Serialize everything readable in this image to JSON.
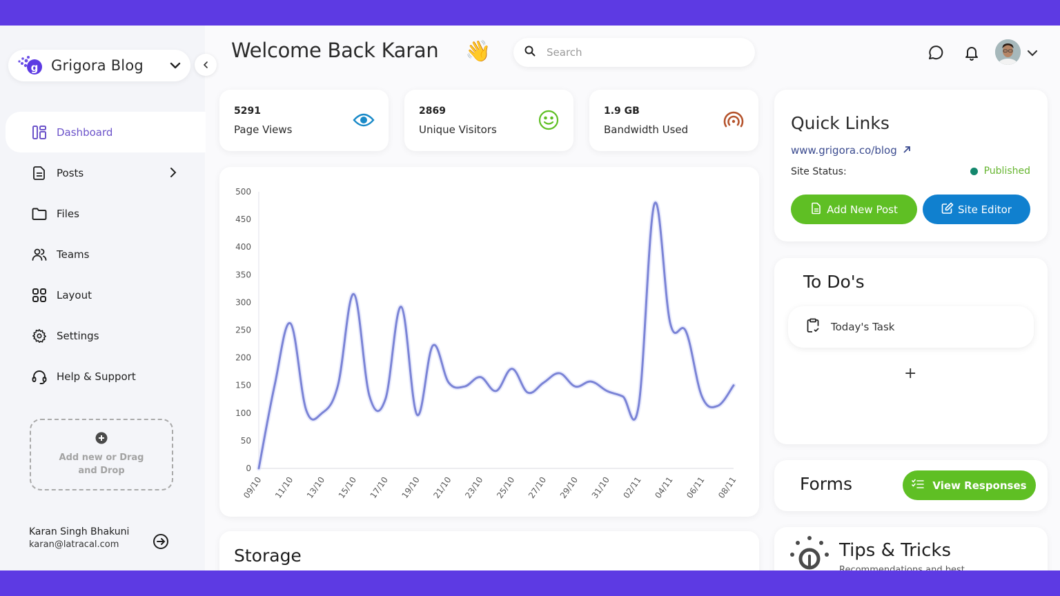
{
  "brand": {
    "name": "Grigora Blog"
  },
  "sidebar": {
    "items": [
      {
        "label": "Dashboard",
        "icon": "dashboard-icon",
        "active": true
      },
      {
        "label": "Posts",
        "icon": "document-icon",
        "has_submenu": true
      },
      {
        "label": "Files",
        "icon": "folder-icon"
      },
      {
        "label": "Teams",
        "icon": "users-icon"
      },
      {
        "label": "Layout",
        "icon": "grid-icon"
      },
      {
        "label": "Settings",
        "icon": "gear-icon"
      },
      {
        "label": "Help & Support",
        "icon": "headset-icon"
      }
    ],
    "dropzone_label": "Add new or Drag and Drop",
    "user": {
      "name": "Karan Singh Bhakuni",
      "email": "karan@latracal.com"
    }
  },
  "header": {
    "welcome": "Welcome Back Karan",
    "wave_emoji": "👋",
    "search_placeholder": "Search"
  },
  "stats": [
    {
      "value": "5291",
      "label": "Page Views",
      "icon": "eye-icon",
      "color": "#1a8ac8"
    },
    {
      "value": "2869",
      "label": "Unique Visitors",
      "icon": "smiley-icon",
      "color": "#5fbf24"
    },
    {
      "value": "1.9 GB",
      "label": "Bandwidth Used",
      "icon": "broadcast-icon",
      "color": "#b5532c"
    }
  ],
  "chart_data": {
    "type": "line",
    "title": "",
    "xlabel": "",
    "ylabel": "",
    "ylim": [
      0,
      500
    ],
    "yticks": [
      0,
      50,
      100,
      150,
      200,
      250,
      300,
      350,
      400,
      450,
      500
    ],
    "x_tick_labels": [
      "09/10",
      "11/10",
      "13/10",
      "15/10",
      "17/10",
      "19/10",
      "21/10",
      "23/10",
      "25/10",
      "27/10",
      "29/10",
      "31/10",
      "02/11",
      "04/11",
      "06/11",
      "08/11"
    ],
    "series": [
      {
        "name": "Page Views",
        "color": "#7b84d6",
        "x": [
          "09/10",
          "10/10",
          "11/10",
          "12/10",
          "13/10",
          "14/10",
          "15/10",
          "16/10",
          "17/10",
          "18/10",
          "19/10",
          "20/10",
          "21/10",
          "22/10",
          "23/10",
          "24/10",
          "25/10",
          "26/10",
          "27/10",
          "28/10",
          "29/10",
          "30/10",
          "31/10",
          "01/11",
          "02/11",
          "03/11",
          "04/11",
          "05/11",
          "06/11",
          "07/11",
          "08/11"
        ],
        "values": [
          0,
          150,
          262,
          105,
          100,
          150,
          315,
          130,
          125,
          292,
          97,
          222,
          155,
          148,
          165,
          140,
          180,
          137,
          155,
          172,
          148,
          157,
          140,
          130,
          113,
          478,
          262,
          247,
          130,
          113,
          150
        ]
      }
    ],
    "grid": false,
    "legend": "none"
  },
  "storage": {
    "title": "Storage"
  },
  "quick_links": {
    "title": "Quick Links",
    "link": "www.grigora.co/blog",
    "status_label": "Site Status:",
    "status": "Published",
    "add_post": "Add New Post",
    "site_editor": "Site Editor"
  },
  "todos": {
    "title": "To Do's",
    "items": [
      {
        "label": "Today's Task"
      }
    ],
    "add_label": "+"
  },
  "forms": {
    "title": "Forms",
    "button": "View Responses"
  },
  "tips": {
    "title": "Tips & Tricks",
    "subtitle": "Recommendations and best"
  }
}
